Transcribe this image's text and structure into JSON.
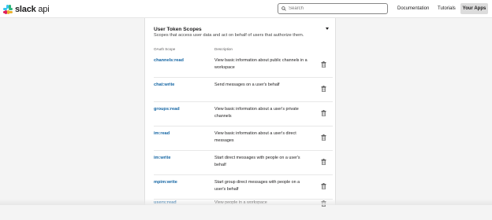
{
  "header": {
    "logo_bold": "slack",
    "logo_light": " api",
    "search": {
      "placeholder": "Search",
      "value": ""
    },
    "nav": [
      {
        "label": "Documentation"
      },
      {
        "label": "Tutorials"
      },
      {
        "label": "Your Apps",
        "active": true
      }
    ]
  },
  "section": {
    "title": "User Token Scopes",
    "description": "Scopes that access user data and act on behalf of users that authorize them.",
    "columns": {
      "scope": "OAuth Scope",
      "description": "Description"
    }
  },
  "scopes": [
    {
      "name": "channels:read",
      "description": "View basic information about public channels in a workspace"
    },
    {
      "name": "chat:write",
      "description": "Send messages on a user's behalf"
    },
    {
      "name": "groups:read",
      "description": "View basic information about a user's private channels"
    },
    {
      "name": "im:read",
      "description": "View basic information about a user's direct messages"
    },
    {
      "name": "im:write",
      "description": "Start direct messages with people on a user's behalf"
    },
    {
      "name": "mpim:write",
      "description": "Start group direct messages with people on a user's behalf"
    },
    {
      "name": "users:read",
      "description": "View people in a workspace"
    }
  ],
  "icons": {
    "logo": "slack-logo-icon",
    "search": "search-icon",
    "collapse": "caret-down-icon",
    "remove": "trash-icon"
  },
  "colors": {
    "scope_link": "#1264a3",
    "active_nav_bg": "#dcdcdc",
    "page_bg": "#f4f4f4"
  }
}
